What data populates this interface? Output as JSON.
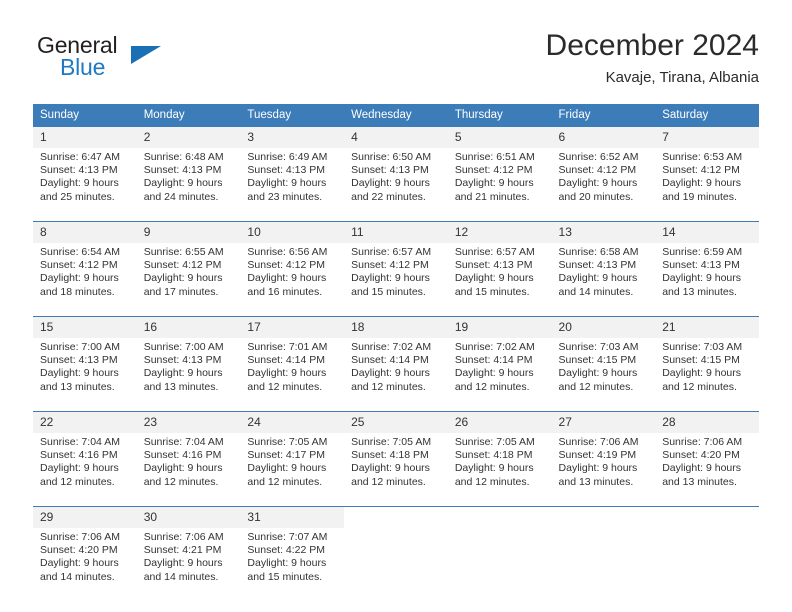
{
  "brand": {
    "name_top": "General",
    "name_bottom": "Blue",
    "flag_icon": "triangle-flag-icon",
    "colors": {
      "blue": "#1e7ac4",
      "dark": "#231f20",
      "header_blue": "#3b7cb9",
      "row_band": "#f2f2f2"
    }
  },
  "header": {
    "title": "December 2024",
    "subtitle": "Kavaje, Tirana, Albania"
  },
  "calendar": {
    "weekday_headers": [
      "Sunday",
      "Monday",
      "Tuesday",
      "Wednesday",
      "Thursday",
      "Friday",
      "Saturday"
    ],
    "weeks": [
      [
        {
          "day": "1",
          "sunrise": "Sunrise: 6:47 AM",
          "sunset": "Sunset: 4:13 PM",
          "daylight_line1": "Daylight: 9 hours",
          "daylight_line2": "and 25 minutes."
        },
        {
          "day": "2",
          "sunrise": "Sunrise: 6:48 AM",
          "sunset": "Sunset: 4:13 PM",
          "daylight_line1": "Daylight: 9 hours",
          "daylight_line2": "and 24 minutes."
        },
        {
          "day": "3",
          "sunrise": "Sunrise: 6:49 AM",
          "sunset": "Sunset: 4:13 PM",
          "daylight_line1": "Daylight: 9 hours",
          "daylight_line2": "and 23 minutes."
        },
        {
          "day": "4",
          "sunrise": "Sunrise: 6:50 AM",
          "sunset": "Sunset: 4:13 PM",
          "daylight_line1": "Daylight: 9 hours",
          "daylight_line2": "and 22 minutes."
        },
        {
          "day": "5",
          "sunrise": "Sunrise: 6:51 AM",
          "sunset": "Sunset: 4:12 PM",
          "daylight_line1": "Daylight: 9 hours",
          "daylight_line2": "and 21 minutes."
        },
        {
          "day": "6",
          "sunrise": "Sunrise: 6:52 AM",
          "sunset": "Sunset: 4:12 PM",
          "daylight_line1": "Daylight: 9 hours",
          "daylight_line2": "and 20 minutes."
        },
        {
          "day": "7",
          "sunrise": "Sunrise: 6:53 AM",
          "sunset": "Sunset: 4:12 PM",
          "daylight_line1": "Daylight: 9 hours",
          "daylight_line2": "and 19 minutes."
        }
      ],
      [
        {
          "day": "8",
          "sunrise": "Sunrise: 6:54 AM",
          "sunset": "Sunset: 4:12 PM",
          "daylight_line1": "Daylight: 9 hours",
          "daylight_line2": "and 18 minutes."
        },
        {
          "day": "9",
          "sunrise": "Sunrise: 6:55 AM",
          "sunset": "Sunset: 4:12 PM",
          "daylight_line1": "Daylight: 9 hours",
          "daylight_line2": "and 17 minutes."
        },
        {
          "day": "10",
          "sunrise": "Sunrise: 6:56 AM",
          "sunset": "Sunset: 4:12 PM",
          "daylight_line1": "Daylight: 9 hours",
          "daylight_line2": "and 16 minutes."
        },
        {
          "day": "11",
          "sunrise": "Sunrise: 6:57 AM",
          "sunset": "Sunset: 4:12 PM",
          "daylight_line1": "Daylight: 9 hours",
          "daylight_line2": "and 15 minutes."
        },
        {
          "day": "12",
          "sunrise": "Sunrise: 6:57 AM",
          "sunset": "Sunset: 4:13 PM",
          "daylight_line1": "Daylight: 9 hours",
          "daylight_line2": "and 15 minutes."
        },
        {
          "day": "13",
          "sunrise": "Sunrise: 6:58 AM",
          "sunset": "Sunset: 4:13 PM",
          "daylight_line1": "Daylight: 9 hours",
          "daylight_line2": "and 14 minutes."
        },
        {
          "day": "14",
          "sunrise": "Sunrise: 6:59 AM",
          "sunset": "Sunset: 4:13 PM",
          "daylight_line1": "Daylight: 9 hours",
          "daylight_line2": "and 13 minutes."
        }
      ],
      [
        {
          "day": "15",
          "sunrise": "Sunrise: 7:00 AM",
          "sunset": "Sunset: 4:13 PM",
          "daylight_line1": "Daylight: 9 hours",
          "daylight_line2": "and 13 minutes."
        },
        {
          "day": "16",
          "sunrise": "Sunrise: 7:00 AM",
          "sunset": "Sunset: 4:13 PM",
          "daylight_line1": "Daylight: 9 hours",
          "daylight_line2": "and 13 minutes."
        },
        {
          "day": "17",
          "sunrise": "Sunrise: 7:01 AM",
          "sunset": "Sunset: 4:14 PM",
          "daylight_line1": "Daylight: 9 hours",
          "daylight_line2": "and 12 minutes."
        },
        {
          "day": "18",
          "sunrise": "Sunrise: 7:02 AM",
          "sunset": "Sunset: 4:14 PM",
          "daylight_line1": "Daylight: 9 hours",
          "daylight_line2": "and 12 minutes."
        },
        {
          "day": "19",
          "sunrise": "Sunrise: 7:02 AM",
          "sunset": "Sunset: 4:14 PM",
          "daylight_line1": "Daylight: 9 hours",
          "daylight_line2": "and 12 minutes."
        },
        {
          "day": "20",
          "sunrise": "Sunrise: 7:03 AM",
          "sunset": "Sunset: 4:15 PM",
          "daylight_line1": "Daylight: 9 hours",
          "daylight_line2": "and 12 minutes."
        },
        {
          "day": "21",
          "sunrise": "Sunrise: 7:03 AM",
          "sunset": "Sunset: 4:15 PM",
          "daylight_line1": "Daylight: 9 hours",
          "daylight_line2": "and 12 minutes."
        }
      ],
      [
        {
          "day": "22",
          "sunrise": "Sunrise: 7:04 AM",
          "sunset": "Sunset: 4:16 PM",
          "daylight_line1": "Daylight: 9 hours",
          "daylight_line2": "and 12 minutes."
        },
        {
          "day": "23",
          "sunrise": "Sunrise: 7:04 AM",
          "sunset": "Sunset: 4:16 PM",
          "daylight_line1": "Daylight: 9 hours",
          "daylight_line2": "and 12 minutes."
        },
        {
          "day": "24",
          "sunrise": "Sunrise: 7:05 AM",
          "sunset": "Sunset: 4:17 PM",
          "daylight_line1": "Daylight: 9 hours",
          "daylight_line2": "and 12 minutes."
        },
        {
          "day": "25",
          "sunrise": "Sunrise: 7:05 AM",
          "sunset": "Sunset: 4:18 PM",
          "daylight_line1": "Daylight: 9 hours",
          "daylight_line2": "and 12 minutes."
        },
        {
          "day": "26",
          "sunrise": "Sunrise: 7:05 AM",
          "sunset": "Sunset: 4:18 PM",
          "daylight_line1": "Daylight: 9 hours",
          "daylight_line2": "and 12 minutes."
        },
        {
          "day": "27",
          "sunrise": "Sunrise: 7:06 AM",
          "sunset": "Sunset: 4:19 PM",
          "daylight_line1": "Daylight: 9 hours",
          "daylight_line2": "and 13 minutes."
        },
        {
          "day": "28",
          "sunrise": "Sunrise: 7:06 AM",
          "sunset": "Sunset: 4:20 PM",
          "daylight_line1": "Daylight: 9 hours",
          "daylight_line2": "and 13 minutes."
        }
      ],
      [
        {
          "day": "29",
          "sunrise": "Sunrise: 7:06 AM",
          "sunset": "Sunset: 4:20 PM",
          "daylight_line1": "Daylight: 9 hours",
          "daylight_line2": "and 14 minutes."
        },
        {
          "day": "30",
          "sunrise": "Sunrise: 7:06 AM",
          "sunset": "Sunset: 4:21 PM",
          "daylight_line1": "Daylight: 9 hours",
          "daylight_line2": "and 14 minutes."
        },
        {
          "day": "31",
          "sunrise": "Sunrise: 7:07 AM",
          "sunset": "Sunset: 4:22 PM",
          "daylight_line1": "Daylight: 9 hours",
          "daylight_line2": "and 15 minutes."
        },
        {
          "day": "",
          "sunrise": "",
          "sunset": "",
          "daylight_line1": "",
          "daylight_line2": ""
        },
        {
          "day": "",
          "sunrise": "",
          "sunset": "",
          "daylight_line1": "",
          "daylight_line2": ""
        },
        {
          "day": "",
          "sunrise": "",
          "sunset": "",
          "daylight_line1": "",
          "daylight_line2": ""
        },
        {
          "day": "",
          "sunrise": "",
          "sunset": "",
          "daylight_line1": "",
          "daylight_line2": ""
        }
      ]
    ]
  }
}
